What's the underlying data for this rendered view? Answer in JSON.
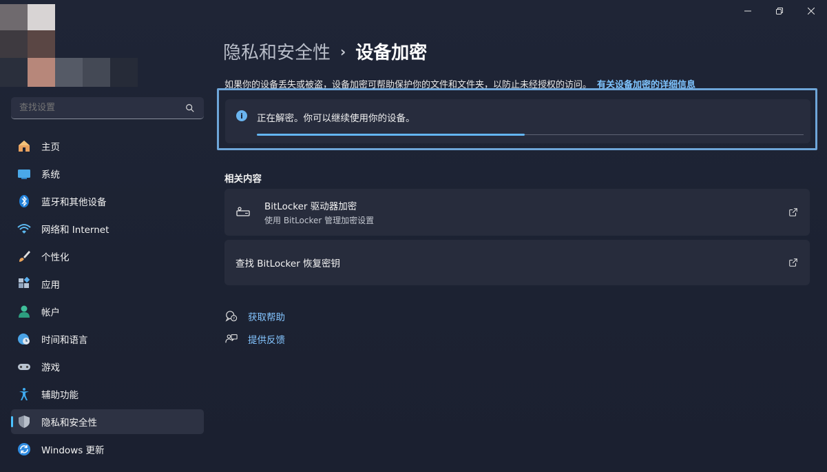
{
  "window_controls": {
    "minimize_icon": "minimize-icon",
    "restore_icon": "restore-icon",
    "close_icon": "close-icon"
  },
  "sidebar": {
    "search": {
      "placeholder": "查找设置",
      "value": ""
    },
    "items": [
      {
        "label": "主页",
        "icon": "home-icon"
      },
      {
        "label": "系统",
        "icon": "system-icon"
      },
      {
        "label": "蓝牙和其他设备",
        "icon": "bluetooth-icon"
      },
      {
        "label": "网络和 Internet",
        "icon": "wifi-icon"
      },
      {
        "label": "个性化",
        "icon": "brush-icon"
      },
      {
        "label": "应用",
        "icon": "apps-icon"
      },
      {
        "label": "帐户",
        "icon": "account-icon"
      },
      {
        "label": "时间和语言",
        "icon": "globe-clock-icon"
      },
      {
        "label": "游戏",
        "icon": "gamepad-icon"
      },
      {
        "label": "辅助功能",
        "icon": "accessibility-icon"
      },
      {
        "label": "隐私和安全性",
        "icon": "shield-icon",
        "active": true
      },
      {
        "label": "Windows 更新",
        "icon": "update-icon"
      }
    ]
  },
  "main": {
    "breadcrumb": {
      "parent": "隐私和安全性",
      "separator": "›",
      "current": "设备加密"
    },
    "description": "如果你的设备丢失或被盗，设备加密可帮助保护你的文件和文件夹，以防止未经授权的访问。",
    "learn_more_link": "有关设备加密的详细信息",
    "status": {
      "text": "正在解密。你可以继续使用你的设备。",
      "progress": 0.49
    },
    "related_title": "相关内容",
    "related": [
      {
        "title": "BitLocker 驱动器加密",
        "subtitle": "使用 BitLocker 管理加密设置",
        "icon": "drive-key-icon"
      },
      {
        "title": "查找 BitLocker 恢复密钥",
        "subtitle": ""
      }
    ],
    "help": {
      "get_help": "获取帮助",
      "feedback": "提供反馈"
    }
  },
  "colors": {
    "accent": "#4cc2ff",
    "link": "#84c5ff",
    "highlight_frame": "#6ea6d9",
    "progress": "#63b5f2"
  }
}
